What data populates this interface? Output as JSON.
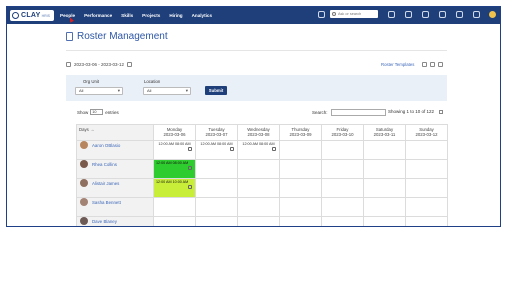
{
  "brand": {
    "name": "CLAY",
    "sub": "HRIS"
  },
  "nav": [
    "People",
    "Performance",
    "Skills",
    "Projects",
    "Hiring",
    "Analytics"
  ],
  "search": {
    "placeholder": "Ask or search"
  },
  "page": {
    "title": "Roster Management",
    "date_range": "2023-03-06 - 2023-03-12",
    "roster_templates": "Roster Templates"
  },
  "filters": {
    "org_unit_label": "Org Unit",
    "org_unit_value": "All",
    "location_label": "Location",
    "location_value": "All",
    "submit_label": "Submit"
  },
  "table_controls": {
    "show": "Show",
    "entries_value": "10",
    "entries": "entries",
    "search_label": "Search:",
    "showing": "Showing 1 to 10 of 122"
  },
  "columns": {
    "days_label": "Days →",
    "days": [
      {
        "day": "Monday",
        "date": "2023-03-06"
      },
      {
        "day": "Tuesday",
        "date": "2023-03-07"
      },
      {
        "day": "Wednesday",
        "date": "2023-03-08"
      },
      {
        "day": "Thursday",
        "date": "2023-03-09"
      },
      {
        "day": "Friday",
        "date": "2023-03-10"
      },
      {
        "day": "Saturday",
        "date": "2023-03-11"
      },
      {
        "day": "Sunday",
        "date": "2023-03-12"
      }
    ]
  },
  "top_shifts": [
    "12:00 AM 08:00 AM",
    "12:00 AM 08:00 AM",
    "12:00 AM 08:00 AM"
  ],
  "employees": [
    {
      "name": "Aaron OBlasio"
    },
    {
      "name": "Rhea Collins",
      "shift": "12:00 AM 08:00 AM"
    },
    {
      "name": "Alistair James",
      "shift": "12:00 AM 10:00 AM"
    },
    {
      "name": "Sasha Bennett"
    },
    {
      "name": "Dave Blaney"
    }
  ],
  "colors": {
    "topbar": "#1e3f7a",
    "accent": "#2e57a7",
    "shift_green": "#2ecc2e",
    "shift_yellow": "#c8ee3a"
  }
}
